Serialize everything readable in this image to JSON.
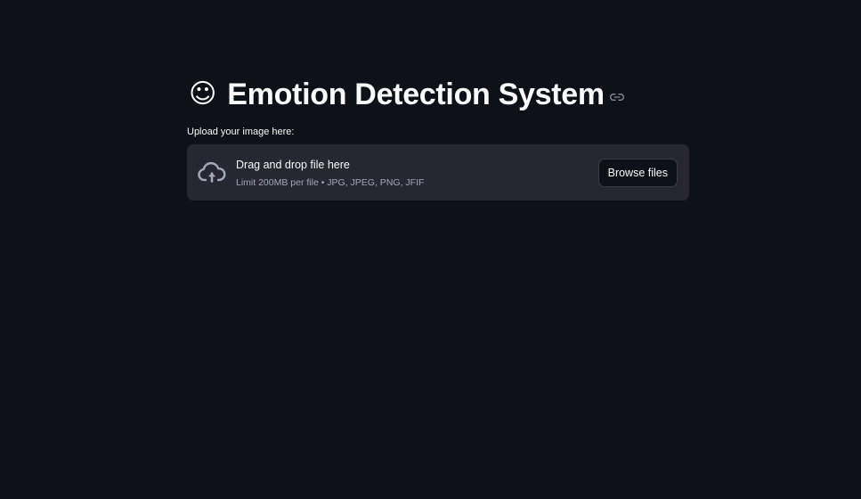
{
  "header": {
    "emoji": "☺",
    "title": "Emotion Detection System"
  },
  "uploader": {
    "label": "Upload your image here:",
    "drop_text": "Drag and drop file here",
    "limit_text": "Limit 200MB per file • JPG, JPEG, PNG, JFIF",
    "browse_label": "Browse files"
  },
  "icons": {
    "anchor": "link-icon",
    "upload": "cloud-upload-icon"
  },
  "colors": {
    "background": "#0e1117",
    "dropzone": "#262730",
    "text": "#fafafa",
    "muted_text": "#a3a8b8"
  }
}
